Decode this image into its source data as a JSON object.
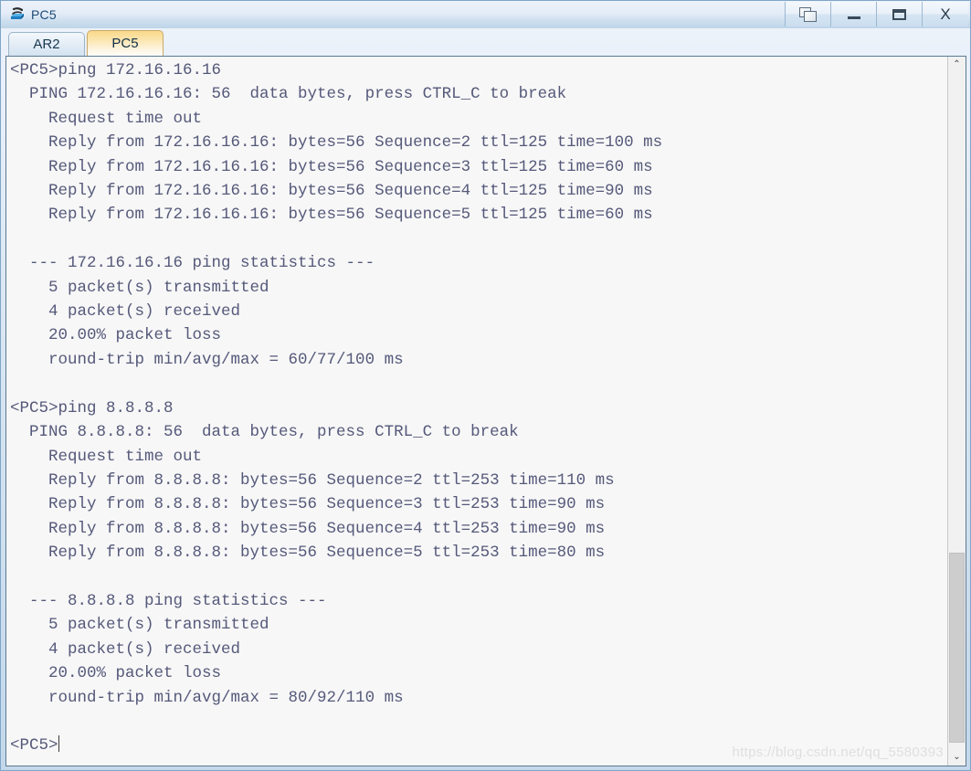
{
  "window": {
    "title": "PC5",
    "icon": "router-device-icon",
    "controls": [
      {
        "name": "restore-button",
        "label": ""
      },
      {
        "name": "minimize-button",
        "label": ""
      },
      {
        "name": "maximize-button",
        "label": ""
      },
      {
        "name": "close-button",
        "label": "X"
      }
    ]
  },
  "tabs": [
    {
      "label": "AR2",
      "active": false
    },
    {
      "label": "PC5",
      "active": true
    }
  ],
  "terminal": {
    "lines": [
      "<PC5>ping 172.16.16.16",
      "  PING 172.16.16.16: 56  data bytes, press CTRL_C to break",
      "    Request time out",
      "    Reply from 172.16.16.16: bytes=56 Sequence=2 ttl=125 time=100 ms",
      "    Reply from 172.16.16.16: bytes=56 Sequence=3 ttl=125 time=60 ms",
      "    Reply from 172.16.16.16: bytes=56 Sequence=4 ttl=125 time=90 ms",
      "    Reply from 172.16.16.16: bytes=56 Sequence=5 ttl=125 time=60 ms",
      "",
      "  --- 172.16.16.16 ping statistics ---",
      "    5 packet(s) transmitted",
      "    4 packet(s) received",
      "    20.00% packet loss",
      "    round-trip min/avg/max = 60/77/100 ms",
      "",
      "<PC5>ping 8.8.8.8",
      "  PING 8.8.8.8: 56  data bytes, press CTRL_C to break",
      "    Request time out",
      "    Reply from 8.8.8.8: bytes=56 Sequence=2 ttl=253 time=110 ms",
      "    Reply from 8.8.8.8: bytes=56 Sequence=3 ttl=253 time=90 ms",
      "    Reply from 8.8.8.8: bytes=56 Sequence=4 ttl=253 time=90 ms",
      "    Reply from 8.8.8.8: bytes=56 Sequence=5 ttl=253 time=80 ms",
      "",
      "  --- 8.8.8.8 ping statistics ---",
      "    5 packet(s) transmitted",
      "    4 packet(s) received",
      "    20.00% packet loss",
      "    round-trip min/avg/max = 80/92/110 ms",
      "",
      "<PC5>"
    ],
    "text_color": "#55597a",
    "background_color": "#f7f7f7"
  },
  "scrollbar": {
    "up_arrow": "⌃",
    "down_arrow": "⌄",
    "thumb_position_percent": 71,
    "thumb_size_percent": 28
  },
  "watermark": "https://blog.csdn.net/qq_5580393"
}
